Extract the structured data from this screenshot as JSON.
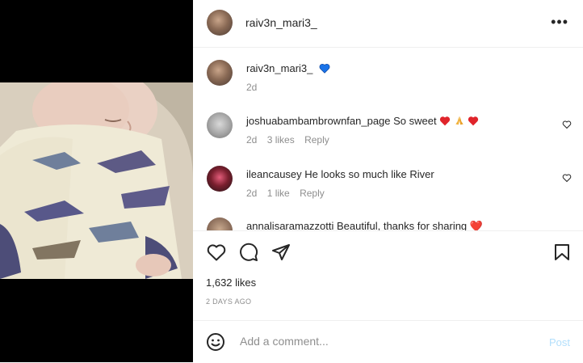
{
  "post": {
    "username": "raiv3n_mari3_",
    "more_icon": "more-horizontal-icon",
    "caption": {
      "username": "raiv3n_mari3_",
      "text": "💙",
      "time": "2d"
    }
  },
  "comments": [
    {
      "username": "joshuabambambrownfan_page",
      "text": "So sweet ❤️🙏❤️",
      "time": "2d",
      "likes": "3 likes",
      "reply": "Reply"
    },
    {
      "username": "ileancausey",
      "text": "He looks so much like River",
      "time": "2d",
      "likes": "1 like",
      "reply": "Reply"
    },
    {
      "username": "annalisaramazzotti",
      "text": "Beautiful, thanks for sharing ❤️"
    }
  ],
  "actions": {
    "likes": "1,632 likes",
    "posted_ago": "2 DAYS AGO"
  },
  "compose": {
    "placeholder": "Add a comment...",
    "post_label": "Post"
  },
  "colors": {
    "link_disabled": "#b2dffc",
    "muted": "#8e8e8e",
    "text": "#262626",
    "heart_blue": "#1a73e8"
  }
}
